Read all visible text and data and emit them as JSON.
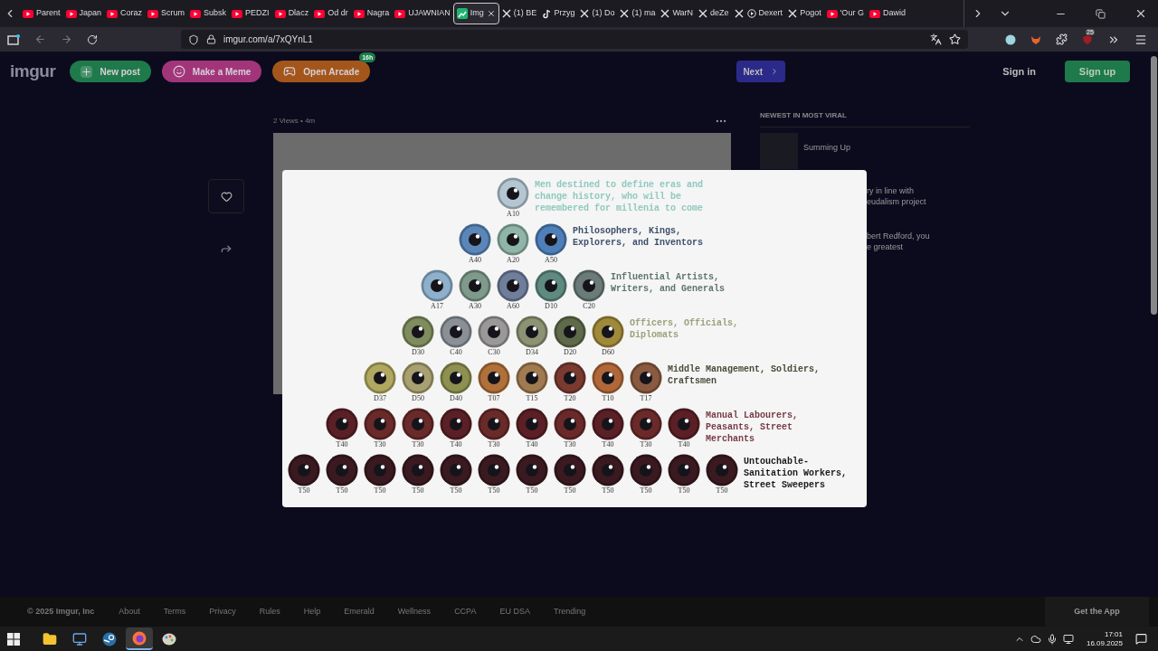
{
  "browser": {
    "tabs": [
      {
        "label": "Parent",
        "kind": "youtube",
        "selected": false
      },
      {
        "label": "Japan",
        "kind": "youtube",
        "selected": false
      },
      {
        "label": "Coraz",
        "kind": "youtube",
        "selected": false
      },
      {
        "label": "Scrum",
        "kind": "youtube",
        "selected": false
      },
      {
        "label": "Subsk",
        "kind": "youtube",
        "selected": false
      },
      {
        "label": "PEDZI",
        "kind": "youtube",
        "selected": false
      },
      {
        "label": "Dlacz",
        "kind": "youtube",
        "selected": false
      },
      {
        "label": "Od dr",
        "kind": "youtube",
        "selected": false
      },
      {
        "label": "Nagra",
        "kind": "youtube",
        "selected": false
      },
      {
        "label": "UJAWNIAN",
        "kind": "youtube",
        "selected": false
      },
      {
        "label": "Img",
        "kind": "imgur",
        "selected": true
      },
      {
        "label": "(1) BE",
        "kind": "x",
        "selected": false
      },
      {
        "label": "Przyg",
        "kind": "tiktok",
        "selected": false
      },
      {
        "label": "(1) Do",
        "kind": "x",
        "selected": false
      },
      {
        "label": "(1) ma",
        "kind": "x",
        "selected": false
      },
      {
        "label": "WarN",
        "kind": "x",
        "selected": false
      },
      {
        "label": "deZe",
        "kind": "x",
        "selected": false
      },
      {
        "label": "Dexert",
        "kind": "x-play",
        "selected": false
      },
      {
        "label": "Pogot",
        "kind": "x",
        "selected": false
      },
      {
        "label": "'Our G",
        "kind": "youtube",
        "selected": false
      },
      {
        "label": "Dawid",
        "kind": "youtube",
        "selected": false
      }
    ],
    "url": "imgur.com/a/7xQYnL1",
    "extension_badge": "25"
  },
  "header": {
    "logo": "imgur",
    "buttons": [
      {
        "label": "New post",
        "kind": "new"
      },
      {
        "label": "Make a Meme",
        "kind": "meme"
      },
      {
        "label": "Open Arcade",
        "kind": "arcade",
        "badge": "16h"
      }
    ],
    "next": "Next",
    "sign_in": "Sign in",
    "sign_up": "Sign up"
  },
  "post": {
    "views": "2 Views",
    "separator": "•",
    "age": "4m"
  },
  "sidebar": {
    "title": "NEWEST IN MOST VIRAL",
    "items": [
      {
        "lines": [
          "Summing Up"
        ]
      },
      {
        "lines": [
          "ry in line with",
          "eudalism project"
        ]
      },
      {
        "lines": [
          "bert Redford, you",
          "e greatest"
        ]
      }
    ]
  },
  "lightbox": {
    "tiers": [
      {
        "caption": "Men destined to define eras and\nchange history, who will be\nremembered for millenia to come",
        "color": "#8fc9bf",
        "eyes": [
          {
            "label": "A10",
            "color": "#b4c6d2"
          }
        ]
      },
      {
        "caption": "Philosophers, Kings,\nExplorers, and Inventors",
        "color": "#3d4f6e",
        "eyes": [
          {
            "label": "A40",
            "color": "#5b86b8"
          },
          {
            "label": "A20",
            "color": "#8fb5a8"
          },
          {
            "label": "A50",
            "color": "#4f7fb8"
          }
        ]
      },
      {
        "caption": "Influential Artists,\nWriters, and Generals",
        "color": "#5f7470",
        "eyes": [
          {
            "label": "A17",
            "color": "#8eb0cc"
          },
          {
            "label": "A30",
            "color": "#7f9a8c"
          },
          {
            "label": "A60",
            "color": "#6f7e9a"
          },
          {
            "label": "D10",
            "color": "#5f8a80"
          },
          {
            "label": "C20",
            "color": "#6a7b78"
          }
        ]
      },
      {
        "caption": "Officers, Officials,\nDiplomats",
        "color": "#9aa27a",
        "eyes": [
          {
            "label": "D30",
            "color": "#7e8c5e"
          },
          {
            "label": "C40",
            "color": "#8a9096"
          },
          {
            "label": "C30",
            "color": "#9a9898"
          },
          {
            "label": "D34",
            "color": "#8c9274"
          },
          {
            "label": "D20",
            "color": "#5f6a4a"
          },
          {
            "label": "D60",
            "color": "#a08a3a"
          }
        ]
      },
      {
        "caption": "Middle Management, Soldiers,\nCraftsmen",
        "color": "#4a4a3a",
        "eyes": [
          {
            "label": "D37",
            "color": "#b0a860"
          },
          {
            "label": "D50",
            "color": "#a8a070"
          },
          {
            "label": "D40",
            "color": "#8e9050"
          },
          {
            "label": "T07",
            "color": "#b0703a"
          },
          {
            "label": "T15",
            "color": "#a07a50"
          },
          {
            "label": "T20",
            "color": "#7a3a30"
          },
          {
            "label": "T10",
            "color": "#b0683a"
          },
          {
            "label": "T17",
            "color": "#8a5a40"
          }
        ]
      },
      {
        "caption": "Manual Labourers,\nPeasants, Street\nMerchants",
        "color": "#7a3a48",
        "eyes": [
          {
            "label": "T40",
            "color": "#5a2025"
          },
          {
            "label": "T30",
            "color": "#6a2a2a"
          },
          {
            "label": "T30",
            "color": "#6a2a2a"
          },
          {
            "label": "T40",
            "color": "#5a2025"
          },
          {
            "label": "T30",
            "color": "#6a2a2a"
          },
          {
            "label": "T40",
            "color": "#5a2025"
          },
          {
            "label": "T30",
            "color": "#6a2a2a"
          },
          {
            "label": "T40",
            "color": "#5a2025"
          },
          {
            "label": "T30",
            "color": "#6a2a2a"
          },
          {
            "label": "T40",
            "color": "#5a2025"
          }
        ]
      },
      {
        "caption": "Untouchable-\nSanitation Workers,\nStreet Sweepers",
        "color": "#1a1a1a",
        "eyes": [
          {
            "label": "T50",
            "color": "#3a1a20"
          },
          {
            "label": "T50",
            "color": "#3a1a20"
          },
          {
            "label": "T50",
            "color": "#3a1a20"
          },
          {
            "label": "T50",
            "color": "#3a1a20"
          },
          {
            "label": "T50",
            "color": "#3a1a20"
          },
          {
            "label": "T50",
            "color": "#3a1a20"
          },
          {
            "label": "T50",
            "color": "#3a1a20"
          },
          {
            "label": "T50",
            "color": "#3a1a20"
          },
          {
            "label": "T50",
            "color": "#3a1a20"
          },
          {
            "label": "T50",
            "color": "#3a1a20"
          },
          {
            "label": "T50",
            "color": "#3a1a20"
          },
          {
            "label": "T50",
            "color": "#3a1a20"
          }
        ]
      }
    ]
  },
  "footer": {
    "copyright": "© 2025 Imgur, Inc",
    "links": [
      "About",
      "Terms",
      "Privacy",
      "Rules",
      "Help",
      "Emerald",
      "Wellness",
      "CCPA",
      "EU DSA",
      "Trending"
    ],
    "app": "Get the App"
  },
  "taskbar": {
    "apps": [
      {
        "kind": "explorer",
        "selected": false
      },
      {
        "kind": "monitor",
        "selected": false
      },
      {
        "kind": "steam",
        "selected": false
      },
      {
        "kind": "firefox",
        "selected": true
      },
      {
        "kind": "paint",
        "selected": false
      }
    ],
    "time": "17:01",
    "date": "16.09.2025"
  }
}
